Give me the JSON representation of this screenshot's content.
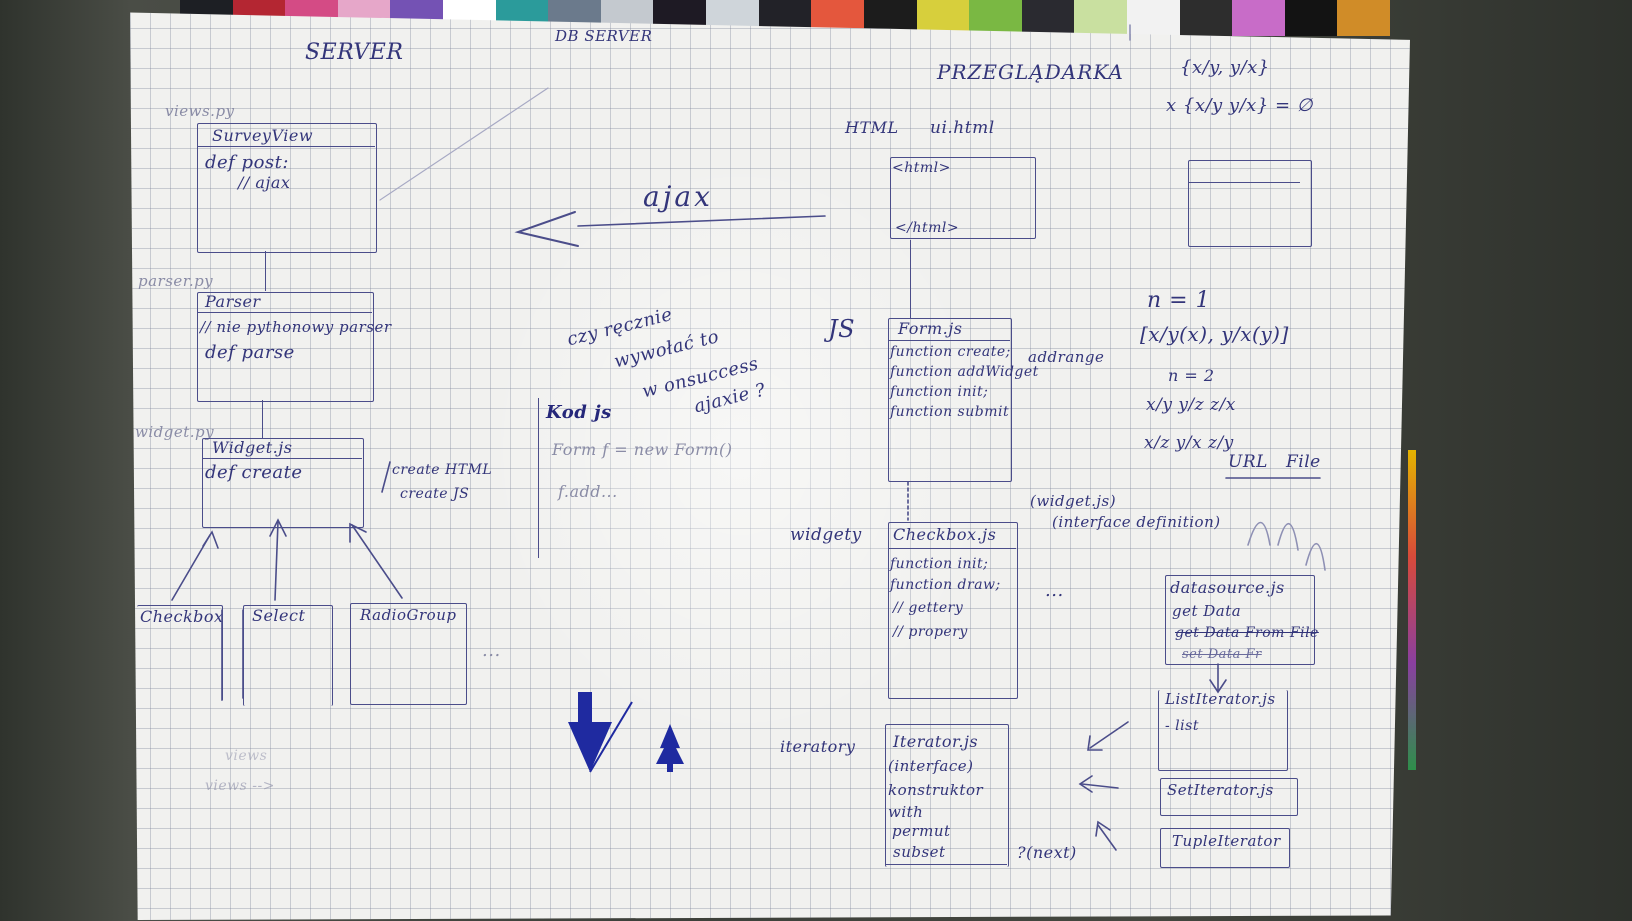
{
  "swatch_colors": [
    "#1d1f24",
    "#b42632",
    "#d44b85",
    "#e6a7c9",
    "#7452b4",
    "#ffffff",
    "#2b9b9b",
    "#6b7a8c",
    "#c4c9cf",
    "#1e1a24",
    "#cfd5da",
    "#222228",
    "#e4573d",
    "#1c1c1c",
    "#d7cf3c",
    "#7ab843",
    "#2a2a30",
    "#c9e0a0",
    "#f2f2f2",
    "#2d2d2d",
    "#c86cc8",
    "#131313",
    "#d08c28"
  ],
  "ink_color": "#33357a",
  "server": {
    "title": "SERVER",
    "db_title": "DB SERVER",
    "views": {
      "file": "views.py",
      "class_name": "SurveyView",
      "method": "def post:",
      "note": "// ajax"
    },
    "parser": {
      "file": "parser.py",
      "class_name": "Parser",
      "note": "// nie pythonowy parser",
      "method": "def parse"
    },
    "widget": {
      "file": "widget.py",
      "class_name": "Widget.js",
      "method": "def create",
      "note_line1": "create HTML",
      "note_line2": "create JS"
    },
    "widgets": [
      "Checkbox",
      "Select",
      "RadioGroup"
    ],
    "ellipsis": "...",
    "faded_line1": "views",
    "faded_line2": "views -->"
  },
  "middle": {
    "ajax_label": "ajax",
    "question_line1": "czy ręcznie",
    "question_line2": "wywołać to",
    "question_line3": "w onsuccess",
    "question_line4": "ajaxie ?",
    "kod_title": "Kod js",
    "kod_line1": "Form f = new Form()",
    "kod_line2": "f.add..."
  },
  "browser": {
    "title": "PRZEGLĄDARKA",
    "html_label": "HTML",
    "html_file": "ui.html",
    "html_open": "<html>",
    "html_close": "</html>",
    "js_label": "JS",
    "form": {
      "file": "Form.js",
      "lines": [
        "function create;",
        "function addWidget",
        "function init;",
        "function submit"
      ],
      "side_note": "addrange"
    },
    "widgety_label": "widgety",
    "checkbox": {
      "file": "Checkbox.js",
      "lines": [
        "function init;",
        "function draw;",
        "// gettery",
        "// propery"
      ],
      "note1": "(widget.js)",
      "note2": "(interface definition)"
    },
    "iteratory_label": "iteratory",
    "iterator": {
      "file": "Iterator.js",
      "lines": [
        "(interface)",
        "konstruktor",
        "with",
        "permut",
        "subset"
      ],
      "next_note": "?(next)"
    },
    "datasource": {
      "file": "datasource.js",
      "lines": [
        "get Data",
        "get Data From File",
        "set Data Fr"
      ]
    },
    "list_iterator": {
      "file": "ListIterator.js",
      "note": "- list"
    },
    "set_iterator": "SetIterator.js",
    "tuple_iterator": "TupleIterator",
    "dots": "...",
    "math": {
      "line1": "{x/y, y/x}",
      "line2": "x {x/y  y/x} = ∅",
      "n1": "n = 1",
      "bracket": "[x/y(x), y/x(y)]",
      "n2": "n = 2",
      "row1": "x/y  y/z  z/x",
      "row2": "x/z  y/x  z/y",
      "url": "URL",
      "file": "File"
    }
  }
}
